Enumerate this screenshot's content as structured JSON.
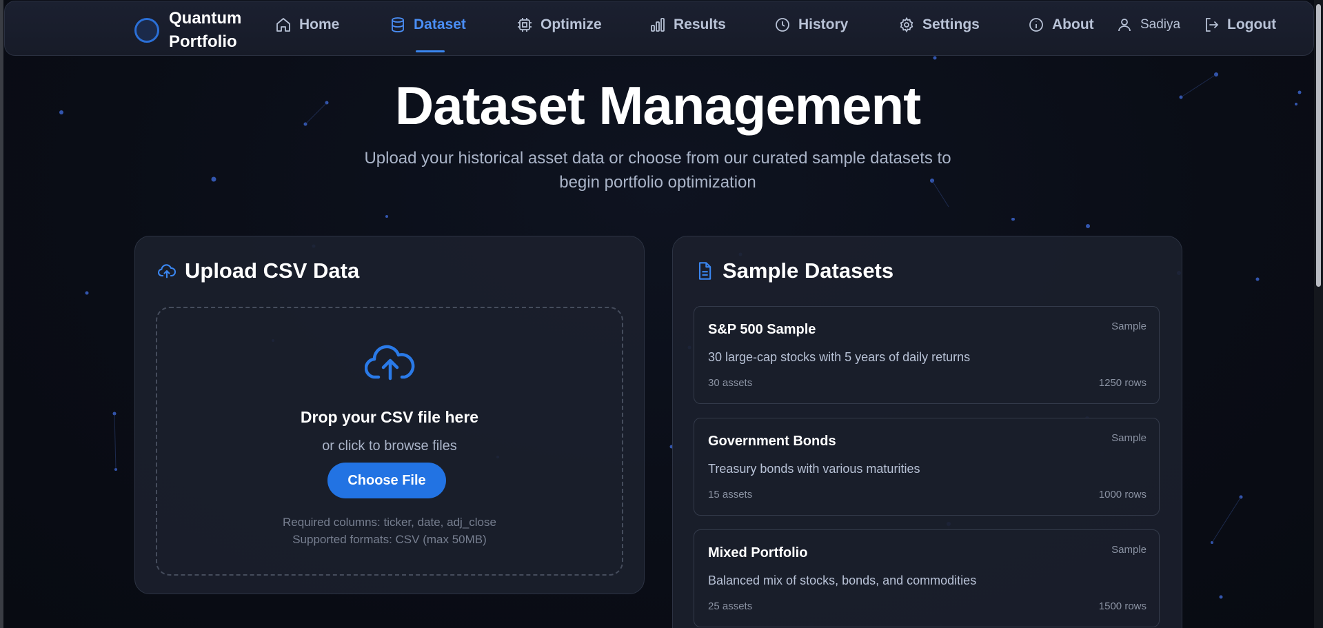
{
  "brand": {
    "line1": "Quantum",
    "line2": "Portfolio"
  },
  "nav": {
    "items": [
      {
        "label": "Home",
        "icon": "home-icon"
      },
      {
        "label": "Dataset",
        "icon": "database-icon",
        "active": true
      },
      {
        "label": "Optimize",
        "icon": "cpu-icon"
      },
      {
        "label": "Results",
        "icon": "bar-chart-icon"
      },
      {
        "label": "History",
        "icon": "clock-icon"
      },
      {
        "label": "Settings",
        "icon": "gear-icon"
      },
      {
        "label": "About",
        "icon": "info-icon"
      }
    ],
    "user": "Sadiya",
    "logout": "Logout"
  },
  "hero": {
    "title": "Dataset Management",
    "subtitle_line1": "Upload your historical asset data or choose from our curated sample datasets to",
    "subtitle_line2": "begin portfolio optimization"
  },
  "upload": {
    "heading": "Upload CSV Data",
    "drop_title": "Drop your CSV file here",
    "drop_sub": "or click to browse files",
    "button": "Choose File",
    "required": "Required columns: ticker, date, adj_close",
    "formats": "Supported formats: CSV (max 50MB)"
  },
  "samples": {
    "heading": "Sample Datasets",
    "items": [
      {
        "name": "S&P 500 Sample",
        "badge": "Sample",
        "description": "30 large-cap stocks with 5 years of daily returns",
        "assets": "30 assets",
        "rows": "1250 rows"
      },
      {
        "name": "Government Bonds",
        "badge": "Sample",
        "description": "Treasury bonds with various maturities",
        "assets": "15 assets",
        "rows": "1000 rows"
      },
      {
        "name": "Mixed Portfolio",
        "badge": "Sample",
        "description": "Balanced mix of stocks, bonds, and commodities",
        "assets": "25 assets",
        "rows": "1500 rows"
      }
    ]
  },
  "colors": {
    "accent": "#2273e3",
    "active_nav": "#4a8ef5",
    "background": "#0b0f18",
    "card": "#1b202c"
  }
}
